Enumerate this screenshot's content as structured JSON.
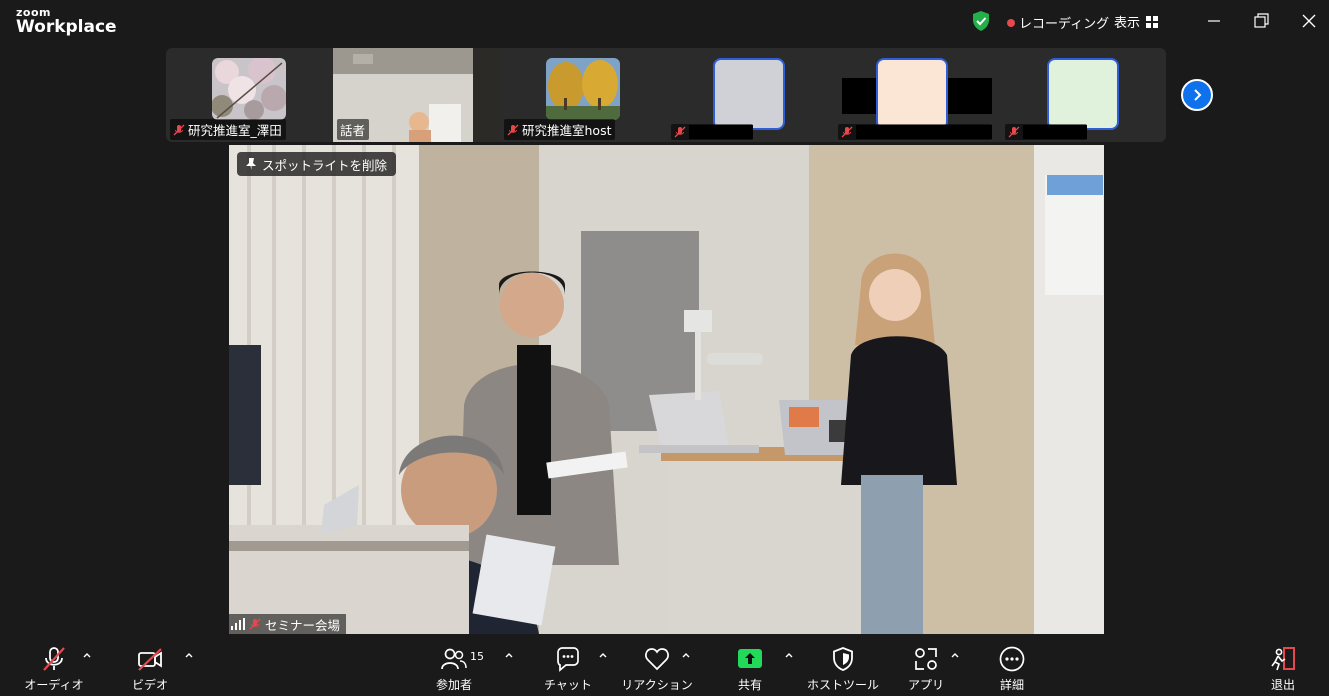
{
  "app": {
    "logo_top": "zoom",
    "logo_bottom": "Workplace"
  },
  "titlebar": {
    "recording_label": "レコーディング",
    "view_label": "表示"
  },
  "thumbnails": [
    {
      "name": "研究推進室_澤田",
      "muted": true
    },
    {
      "name": "話者",
      "muted": false
    },
    {
      "name": "研究推進室host",
      "muted": true
    },
    {
      "name": "",
      "muted": true,
      "avatar_color": "#d0d1d6"
    },
    {
      "name": "",
      "muted": true,
      "avatar_color": "#fbe6d6"
    },
    {
      "name": "",
      "muted": true,
      "avatar_color": "#e0f1dc"
    }
  ],
  "main_video": {
    "spotlight_button": "スポットライトを削除",
    "participant_label": "セミナー会場"
  },
  "toolbar": {
    "audio": "オーディオ",
    "video": "ビデオ",
    "participants": "参加者",
    "participants_count": "15",
    "chat": "チャット",
    "reactions": "リアクション",
    "share": "共有",
    "host_tools": "ホストツール",
    "apps": "アプリ",
    "more": "詳細",
    "leave": "退出"
  },
  "colors": {
    "accent_blue": "#0e72ed",
    "share_green": "#23d959",
    "leave_red": "#e5484d",
    "security_green": "#23b04b"
  }
}
